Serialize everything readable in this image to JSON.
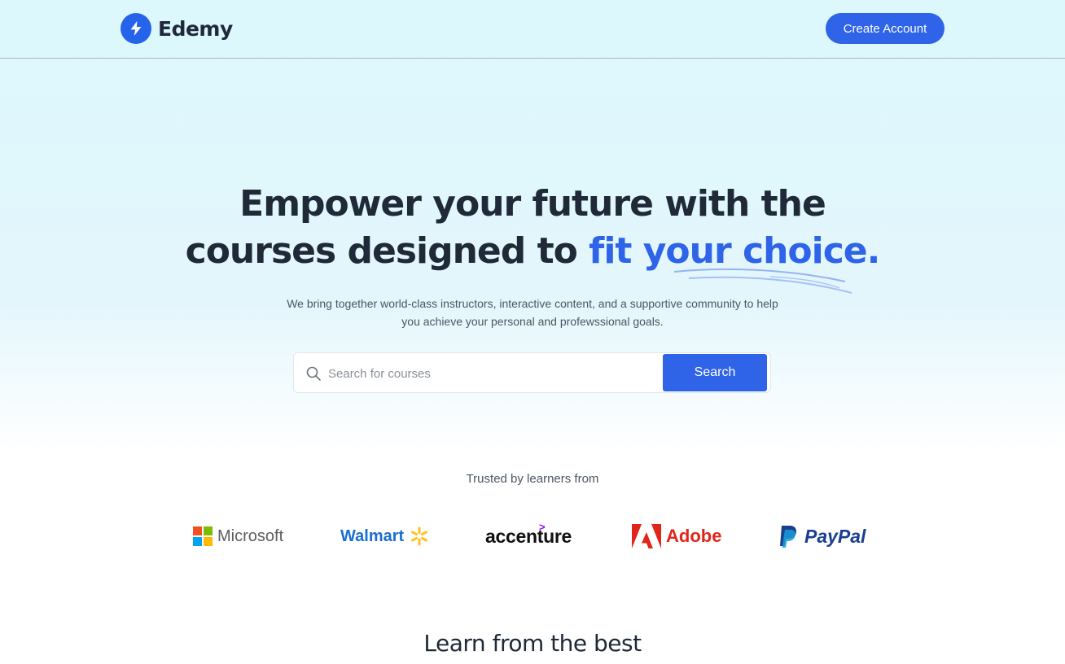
{
  "header": {
    "brand_name": "Edemy",
    "create_account_label": "Create Account"
  },
  "hero": {
    "headline_line1": "Empower your future with the",
    "headline_line2_plain": "courses designed to ",
    "headline_line2_accent": "fit your choice.",
    "subtitle_line1": "We bring together world-class instructors, interactive content, and a supportive community to help",
    "subtitle_line2": "you achieve your personal and profewssional goals."
  },
  "search": {
    "placeholder": "Search for courses",
    "value": "",
    "button_label": "Search"
  },
  "trusted": {
    "label": "Trusted by learners from",
    "companies": [
      "Microsoft",
      "Walmart",
      "accenture",
      "Adobe",
      "PayPal"
    ]
  },
  "section": {
    "title": "Learn from the best"
  },
  "colors": {
    "primary": "#2f63e8",
    "accent_text": "#2f63e8",
    "heading": "#1f2937",
    "bg_top": "#dcf8fd"
  }
}
